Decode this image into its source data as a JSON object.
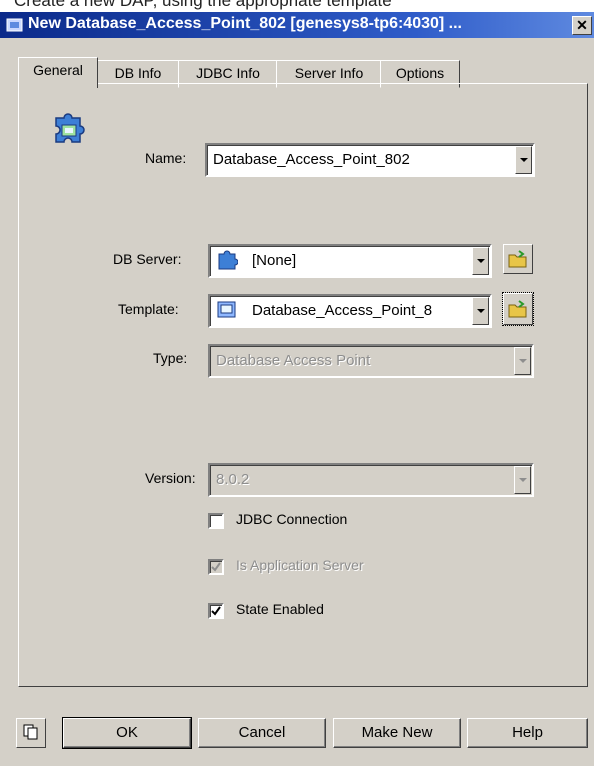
{
  "caption": "Create a new DAP, using the appropriate template",
  "window": {
    "title": "New Database_Access_Point_802 [genesys8-tp6:4030] ...",
    "close_glyph": "✕"
  },
  "tabs": [
    {
      "label": "General",
      "active": true
    },
    {
      "label": "DB Info",
      "active": false
    },
    {
      "label": "JDBC Info",
      "active": false
    },
    {
      "label": "Server Info",
      "active": false
    },
    {
      "label": "Options",
      "active": false
    }
  ],
  "form": {
    "name": {
      "label": "Name:",
      "value": "Database_Access_Point_802"
    },
    "db_server": {
      "label": "DB Server:",
      "value": "[None]"
    },
    "template": {
      "label": "Template:",
      "value": "Database_Access_Point_8"
    },
    "type": {
      "label": "Type:",
      "value": "Database Access Point",
      "disabled": true
    },
    "version": {
      "label": "Version:",
      "value": "8.0.2",
      "disabled": true
    }
  },
  "checkboxes": {
    "jdbc": {
      "label": "JDBC Connection",
      "checked": false
    },
    "app_server": {
      "label": "Is Application Server",
      "checked": true,
      "disabled": true
    },
    "state": {
      "label": "State Enabled",
      "checked": true
    }
  },
  "buttons": {
    "ok": "OK",
    "cancel": "Cancel",
    "make_new": "Make New",
    "help": "Help"
  },
  "icons": {
    "app": "app-icon",
    "dap": "dap-object-icon",
    "db_server": "puzzle-icon",
    "template": "template-icon",
    "browse": "folder-browse-icon",
    "copy": "copy-icon"
  },
  "colors": {
    "title_bar": "#0b2a8a",
    "dialog_face": "#d4d0c8",
    "folder": "#e8c547"
  }
}
